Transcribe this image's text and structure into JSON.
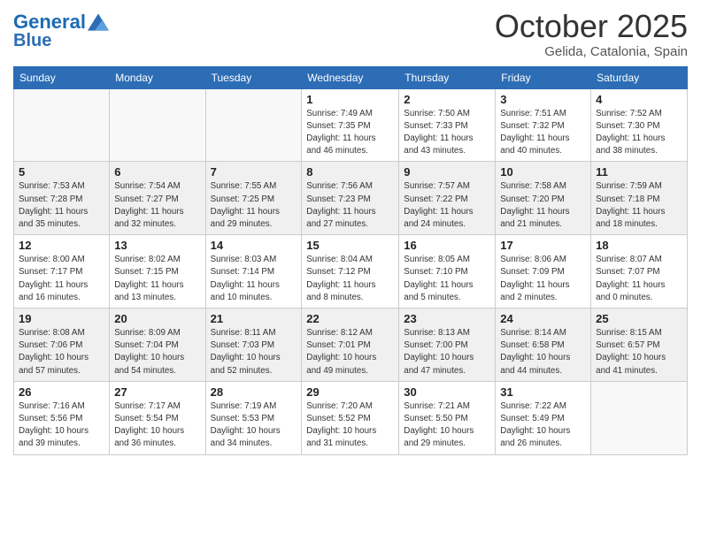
{
  "header": {
    "logo_line1": "General",
    "logo_line2": "Blue",
    "month": "October 2025",
    "location": "Gelida, Catalonia, Spain"
  },
  "weekdays": [
    "Sunday",
    "Monday",
    "Tuesday",
    "Wednesday",
    "Thursday",
    "Friday",
    "Saturday"
  ],
  "weeks": [
    {
      "days": [
        {
          "num": "",
          "info": ""
        },
        {
          "num": "",
          "info": ""
        },
        {
          "num": "",
          "info": ""
        },
        {
          "num": "1",
          "info": "Sunrise: 7:49 AM\nSunset: 7:35 PM\nDaylight: 11 hours\nand 46 minutes."
        },
        {
          "num": "2",
          "info": "Sunrise: 7:50 AM\nSunset: 7:33 PM\nDaylight: 11 hours\nand 43 minutes."
        },
        {
          "num": "3",
          "info": "Sunrise: 7:51 AM\nSunset: 7:32 PM\nDaylight: 11 hours\nand 40 minutes."
        },
        {
          "num": "4",
          "info": "Sunrise: 7:52 AM\nSunset: 7:30 PM\nDaylight: 11 hours\nand 38 minutes."
        }
      ]
    },
    {
      "days": [
        {
          "num": "5",
          "info": "Sunrise: 7:53 AM\nSunset: 7:28 PM\nDaylight: 11 hours\nand 35 minutes."
        },
        {
          "num": "6",
          "info": "Sunrise: 7:54 AM\nSunset: 7:27 PM\nDaylight: 11 hours\nand 32 minutes."
        },
        {
          "num": "7",
          "info": "Sunrise: 7:55 AM\nSunset: 7:25 PM\nDaylight: 11 hours\nand 29 minutes."
        },
        {
          "num": "8",
          "info": "Sunrise: 7:56 AM\nSunset: 7:23 PM\nDaylight: 11 hours\nand 27 minutes."
        },
        {
          "num": "9",
          "info": "Sunrise: 7:57 AM\nSunset: 7:22 PM\nDaylight: 11 hours\nand 24 minutes."
        },
        {
          "num": "10",
          "info": "Sunrise: 7:58 AM\nSunset: 7:20 PM\nDaylight: 11 hours\nand 21 minutes."
        },
        {
          "num": "11",
          "info": "Sunrise: 7:59 AM\nSunset: 7:18 PM\nDaylight: 11 hours\nand 18 minutes."
        }
      ]
    },
    {
      "days": [
        {
          "num": "12",
          "info": "Sunrise: 8:00 AM\nSunset: 7:17 PM\nDaylight: 11 hours\nand 16 minutes."
        },
        {
          "num": "13",
          "info": "Sunrise: 8:02 AM\nSunset: 7:15 PM\nDaylight: 11 hours\nand 13 minutes."
        },
        {
          "num": "14",
          "info": "Sunrise: 8:03 AM\nSunset: 7:14 PM\nDaylight: 11 hours\nand 10 minutes."
        },
        {
          "num": "15",
          "info": "Sunrise: 8:04 AM\nSunset: 7:12 PM\nDaylight: 11 hours\nand 8 minutes."
        },
        {
          "num": "16",
          "info": "Sunrise: 8:05 AM\nSunset: 7:10 PM\nDaylight: 11 hours\nand 5 minutes."
        },
        {
          "num": "17",
          "info": "Sunrise: 8:06 AM\nSunset: 7:09 PM\nDaylight: 11 hours\nand 2 minutes."
        },
        {
          "num": "18",
          "info": "Sunrise: 8:07 AM\nSunset: 7:07 PM\nDaylight: 11 hours\nand 0 minutes."
        }
      ]
    },
    {
      "days": [
        {
          "num": "19",
          "info": "Sunrise: 8:08 AM\nSunset: 7:06 PM\nDaylight: 10 hours\nand 57 minutes."
        },
        {
          "num": "20",
          "info": "Sunrise: 8:09 AM\nSunset: 7:04 PM\nDaylight: 10 hours\nand 54 minutes."
        },
        {
          "num": "21",
          "info": "Sunrise: 8:11 AM\nSunset: 7:03 PM\nDaylight: 10 hours\nand 52 minutes."
        },
        {
          "num": "22",
          "info": "Sunrise: 8:12 AM\nSunset: 7:01 PM\nDaylight: 10 hours\nand 49 minutes."
        },
        {
          "num": "23",
          "info": "Sunrise: 8:13 AM\nSunset: 7:00 PM\nDaylight: 10 hours\nand 47 minutes."
        },
        {
          "num": "24",
          "info": "Sunrise: 8:14 AM\nSunset: 6:58 PM\nDaylight: 10 hours\nand 44 minutes."
        },
        {
          "num": "25",
          "info": "Sunrise: 8:15 AM\nSunset: 6:57 PM\nDaylight: 10 hours\nand 41 minutes."
        }
      ]
    },
    {
      "days": [
        {
          "num": "26",
          "info": "Sunrise: 7:16 AM\nSunset: 5:56 PM\nDaylight: 10 hours\nand 39 minutes."
        },
        {
          "num": "27",
          "info": "Sunrise: 7:17 AM\nSunset: 5:54 PM\nDaylight: 10 hours\nand 36 minutes."
        },
        {
          "num": "28",
          "info": "Sunrise: 7:19 AM\nSunset: 5:53 PM\nDaylight: 10 hours\nand 34 minutes."
        },
        {
          "num": "29",
          "info": "Sunrise: 7:20 AM\nSunset: 5:52 PM\nDaylight: 10 hours\nand 31 minutes."
        },
        {
          "num": "30",
          "info": "Sunrise: 7:21 AM\nSunset: 5:50 PM\nDaylight: 10 hours\nand 29 minutes."
        },
        {
          "num": "31",
          "info": "Sunrise: 7:22 AM\nSunset: 5:49 PM\nDaylight: 10 hours\nand 26 minutes."
        },
        {
          "num": "",
          "info": ""
        }
      ]
    }
  ]
}
